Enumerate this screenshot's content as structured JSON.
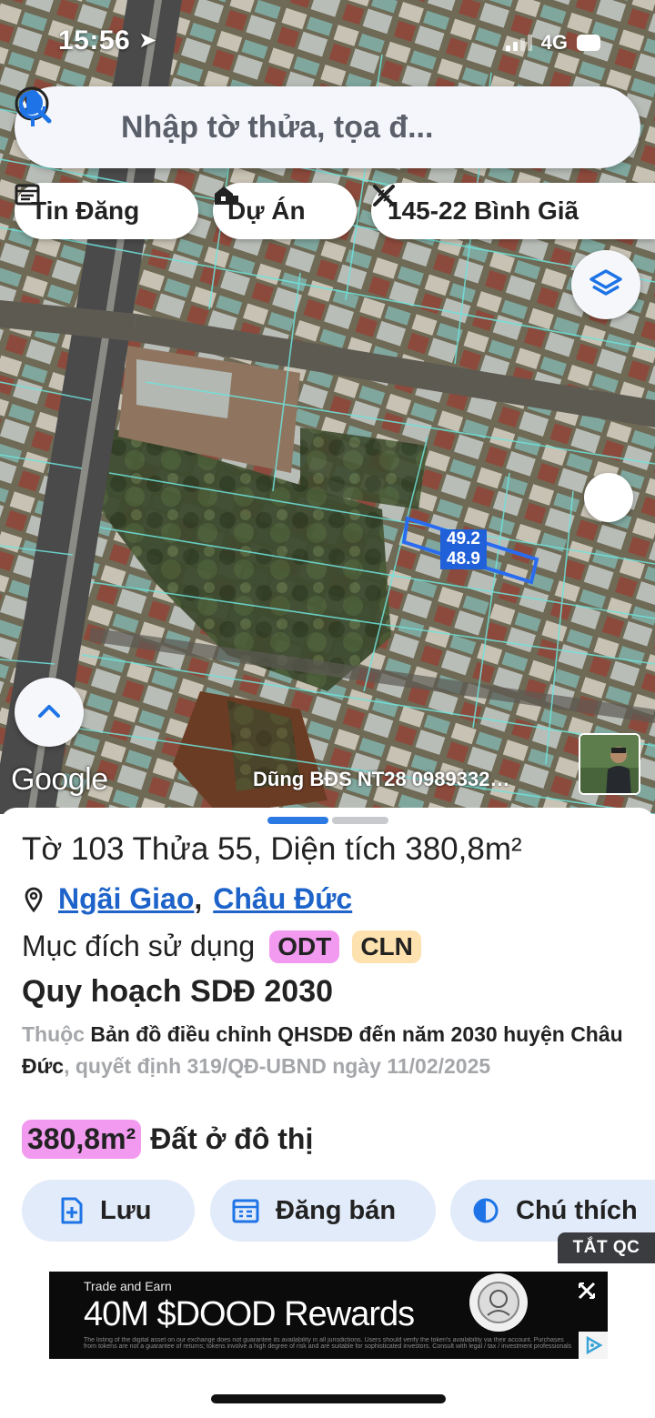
{
  "status_bar": {
    "time": "15:56",
    "network": "4G"
  },
  "search": {
    "placeholder": "Nhập tờ thửa, tọa đ..."
  },
  "chips": {
    "news": "Tin Đăng",
    "projects": "Dự Án",
    "place": "145-22 Bình Giã"
  },
  "map": {
    "parcel_label_top": "49.2",
    "parcel_label_bottom": "48.9",
    "google_logo": "Google",
    "watermark": "Dũng BĐS NT28 0989332…"
  },
  "sheet": {
    "title": "Tờ 103 Thửa 55, Diện tích 380,8m²",
    "location": {
      "commune": "Ngãi Giao",
      "separator": ",",
      "district": "Châu Đức"
    },
    "purpose_label": "Mục đích sử dụng",
    "purpose_codes": [
      "ODT",
      "CLN"
    ],
    "plan_title": "Quy hoạch SDĐ 2030",
    "plan_desc": {
      "prefix": "Thuộc",
      "map_name": "Bản đồ điều chỉnh QHSDĐ đến năm 2030 huyện Châu Đức",
      "decision": ", quyết định 319/QĐ-UBND ngày 11/02/2025"
    },
    "area_value": "380,8m²",
    "area_type": "Đất ở đô thị",
    "actions": {
      "save": "Lưu",
      "post": "Đăng bán",
      "legend": "Chú thích"
    }
  },
  "ad": {
    "off_label": "TẮT QC",
    "small_text": "Trade and Earn",
    "headline": "40M $DOOD Rewards",
    "fine_print": "The listing of the digital asset on our exchange does not guarantee its availability in all jurisdictions. Users should verify the token's availability via their account. Purchases from tokens are not a guarantee of returns; tokens involve a high degree of risk and are suitable for sophisticated investors. Consult with legal / tax / investment professionals before acting."
  },
  "colors": {
    "accent_blue": "#1d63c9",
    "badge_pink": "#f29af0",
    "badge_peach": "#fde1ae",
    "button_bg": "#e2ebfa"
  }
}
